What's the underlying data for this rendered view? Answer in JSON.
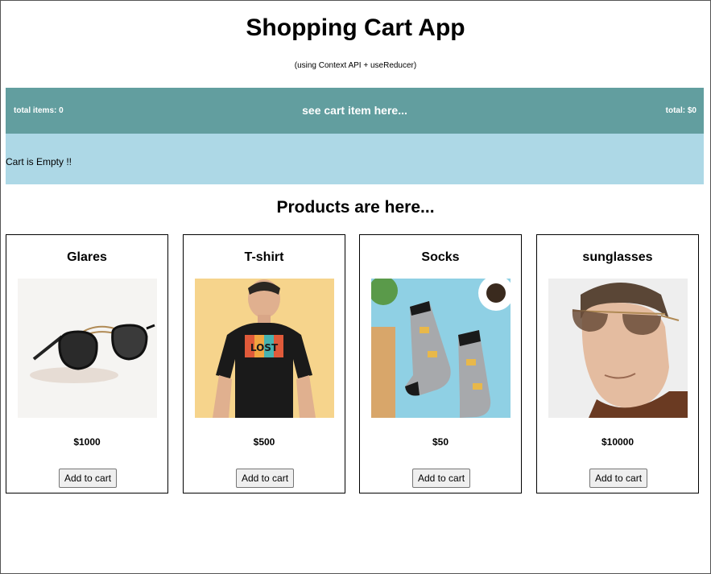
{
  "header": {
    "title": "Shopping Cart App",
    "subtitle": "(using Context API + useReducer)"
  },
  "cart": {
    "total_items": "total items: 0",
    "center_text": "see cart item here...",
    "total": "total: $0",
    "empty_message": "Cart is Empty !!",
    "bar_color": "#629e9f",
    "body_color": "#add8e6"
  },
  "products_heading": "Products are here...",
  "products": [
    {
      "name": "Glares",
      "price": "$1000",
      "button_label": "Add to cart",
      "image": "sunglasses-product-image"
    },
    {
      "name": "T-shirt",
      "price": "$500",
      "button_label": "Add to cart",
      "image": "tshirt-product-image"
    },
    {
      "name": "Socks",
      "price": "$50",
      "button_label": "Add to cart",
      "image": "socks-product-image"
    },
    {
      "name": "sunglasses",
      "price": "$10000",
      "button_label": "Add to cart",
      "image": "man-sunglasses-product-image"
    }
  ]
}
